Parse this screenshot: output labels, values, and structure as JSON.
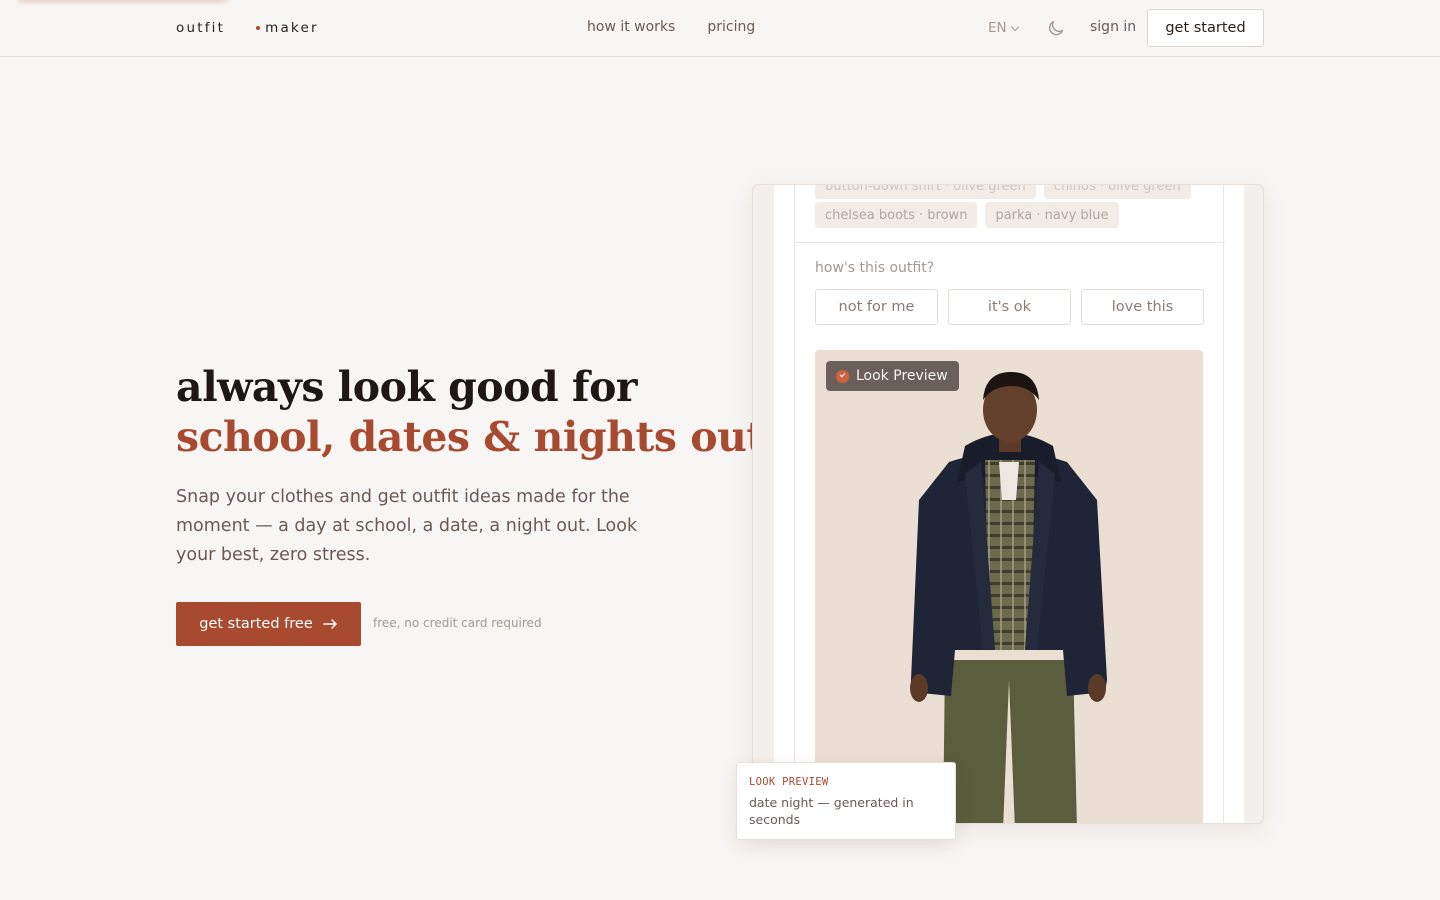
{
  "header": {
    "logo_word1": "outfit",
    "logo_word2": "maker",
    "nav": [
      "how it works",
      "pricing"
    ],
    "language": "EN",
    "theme_icon": "moon-icon",
    "sign_in": "sign in",
    "get_started": "get started"
  },
  "hero": {
    "title_line1": "always look good for",
    "title_line2": "school, dates & nights out",
    "subtitle": "Snap your clothes and get outfit ideas made for the moment — a day at school, a date, a night out. Look your best, zero stress.",
    "cta_label": "get started free",
    "cta_icon": "arrow-right-icon",
    "cta_note": "free, no credit card required"
  },
  "mock": {
    "chips_top": [
      "button-down shirt · olive green",
      "chinos · olive green"
    ],
    "chips": [
      "chelsea boots · brown",
      "parka · navy blue"
    ],
    "rating_question": "how's this outfit?",
    "rating_options": [
      "not for me",
      "it's ok",
      "love this"
    ],
    "photo_badge": "Look Preview",
    "preview_card_label": "LOOK PREVIEW",
    "preview_card_text": "date night — generated in seconds"
  },
  "colors": {
    "accent": "#a84a30",
    "background": "#f8f6f4",
    "text": "#2a211d",
    "muted": "#6a5a52"
  }
}
